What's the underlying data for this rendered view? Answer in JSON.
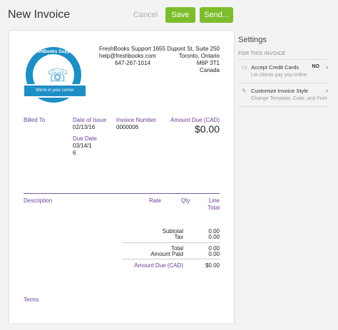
{
  "header": {
    "title": "New Invoice",
    "cancel_label": "Cancel",
    "save_label": "Save",
    "send_label": "Send..."
  },
  "logo": {
    "text": "FreshBooks Support Team",
    "ribbon": "We're in your corner"
  },
  "company": {
    "name": "FreshBooks Support",
    "email": "help@freshbooks.com",
    "phone": "647-267-1014",
    "address1": "1655 Dupont St, Suite 250",
    "address2": "Toronto, Ontario",
    "postal": "M6P 3T1",
    "country": "Canada"
  },
  "invoice": {
    "billed_to_label": "Billed To",
    "date_issue_label": "Date of Issue",
    "date_issue": "02/13/16",
    "invoice_number_label": "Invoice Number",
    "invoice_number": "0000006",
    "amount_due_label": "Amount Due (CAD)",
    "amount_due": "$0.00",
    "due_date_label": "Due Date",
    "due_date_1": "03/14/1",
    "due_date_2": "6"
  },
  "table": {
    "description": "Description",
    "rate": "Rate",
    "qty": "Qty",
    "line_total": "Line Total"
  },
  "totals": {
    "subtotal_label": "Subtotal",
    "subtotal": "0.00",
    "tax_label": "Tax",
    "tax": "0.00",
    "total_label": "Total",
    "total": "0.00",
    "paid_label": "Amount Paid",
    "paid": "0.00",
    "due_label": "Amount Due (CAD)",
    "due": "$0.00"
  },
  "terms_label": "Terms",
  "sidebar": {
    "title": "Settings",
    "subtitle": "FOR THIS INVOICE",
    "cards_label": "Accept Credit Cards",
    "cards_state": "NO",
    "cards_desc": "Let clients pay you online",
    "style_label": "Customize Invoice Style",
    "style_desc": "Change Template, Color, and Font"
  },
  "colors": {
    "accent": "#7cbd2b",
    "purple": "#6a3d98",
    "logo_blue": "#1e8fc5"
  }
}
